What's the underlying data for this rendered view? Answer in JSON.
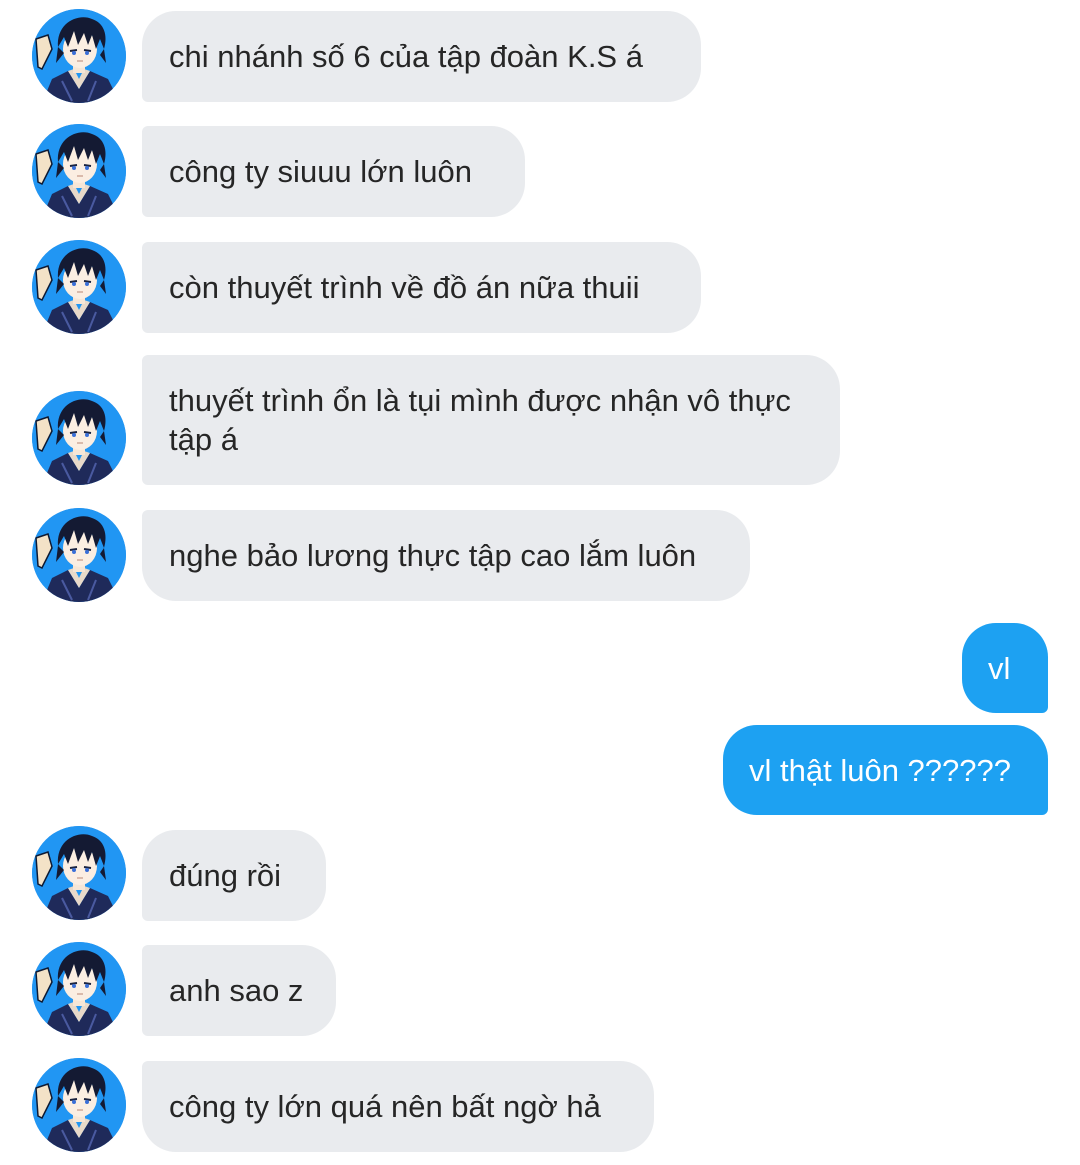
{
  "colors": {
    "incoming_bubble": "#e9ebee",
    "outgoing_bubble": "#1da1f2",
    "incoming_text": "#262626",
    "outgoing_text": "#ffffff",
    "avatar_background": "#1e88e5"
  },
  "contact": {
    "avatar_icon": "anime-boy-avatar-icon"
  },
  "messages": [
    {
      "side": "incoming",
      "text": "chi nhánh số 6 của tập đoàn K.S á"
    },
    {
      "side": "incoming",
      "text": "công ty siuuu lớn luôn"
    },
    {
      "side": "incoming",
      "text": "còn thuyết trình về đồ án nữa thuii"
    },
    {
      "side": "incoming",
      "text": "thuyết trình ổn là tụi mình được nhận vô thực tập á"
    },
    {
      "side": "incoming",
      "text": "nghe bảo lương thực tập cao lắm luôn"
    },
    {
      "side": "outgoing",
      "text": "vl"
    },
    {
      "side": "outgoing",
      "text": "vl thật luôn ??????"
    },
    {
      "side": "incoming",
      "text": "đúng rồi"
    },
    {
      "side": "incoming",
      "text": "anh sao z"
    },
    {
      "side": "incoming",
      "text": "công ty lớn quá nên bất ngờ hả"
    }
  ]
}
